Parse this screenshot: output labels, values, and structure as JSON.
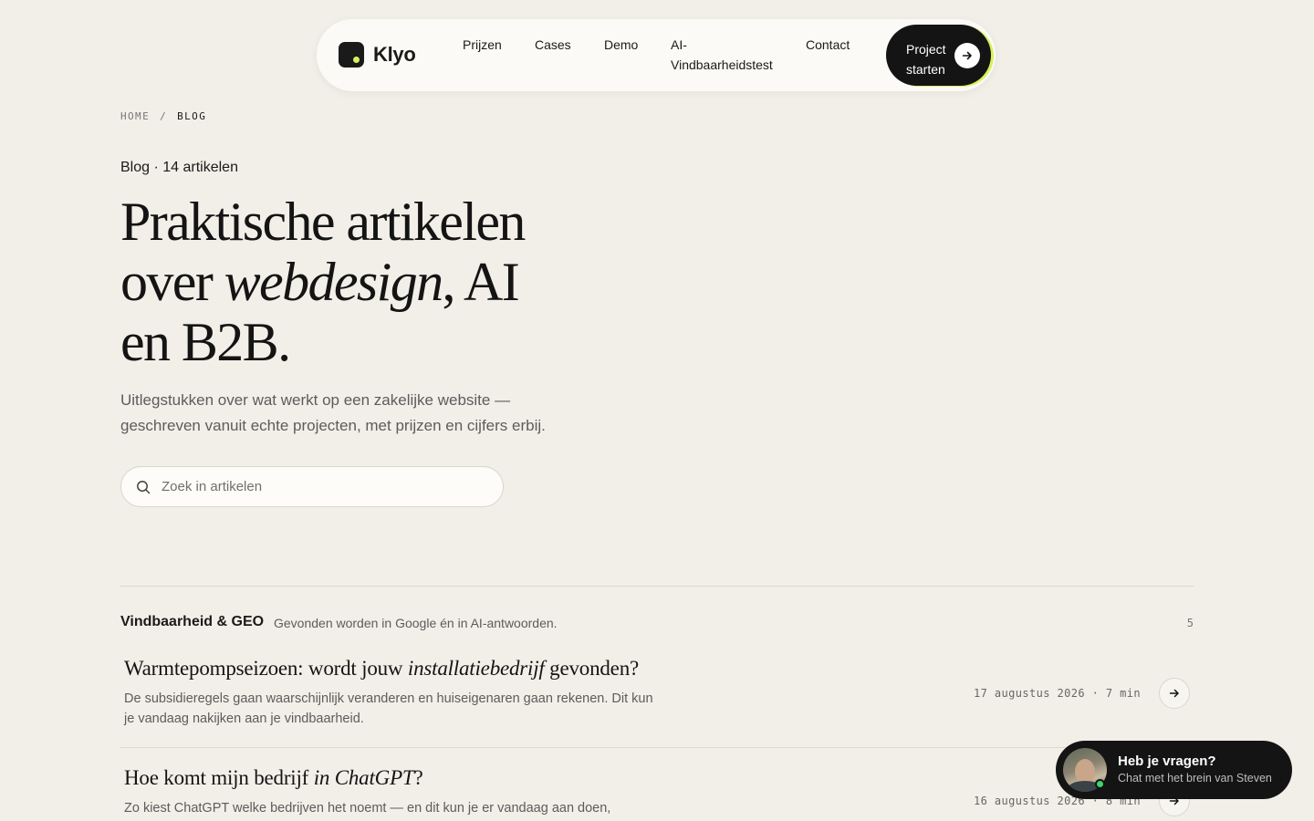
{
  "nav": {
    "brand": "Klyo",
    "links": [
      "Prijzen",
      "Cases",
      "Demo",
      "AI-\nVindbaarheidstest",
      "Contact"
    ],
    "cta_label": "Project starten",
    "accent": "#d7f25c"
  },
  "breadcrumb": {
    "home": "HOME",
    "sep": "/",
    "current": "BLOG"
  },
  "hero": {
    "kicker": "Blog · 14 artikelen",
    "title_line1": "Praktische artikelen",
    "title_over": "over ",
    "title_em": "webdesign",
    "title_after": ", AI",
    "title_line3": "en B2B.",
    "subtitle": "Uitlegstukken over wat werkt op een zakelijke website — geschreven vanuit echte projecten, met prijzen en cijfers erbij."
  },
  "search": {
    "placeholder": "Zoek in artikelen",
    "value": ""
  },
  "section": {
    "name": "Vindbaarheid & GEO",
    "description": "Gevonden worden in Google én in AI-antwoorden.",
    "count": "5"
  },
  "articles": [
    {
      "title_before": "Warmtepompseizoen: wordt jouw ",
      "title_em": "installatiebedrijf",
      "title_after": " gevonden?",
      "excerpt": "De subsidieregels gaan waarschijnlijk veranderen en huiseigenaren gaan rekenen. Dit kun je vandaag nakijken aan je vindbaarheid.",
      "meta": "17 augustus 2026 · 7 min"
    },
    {
      "title_before": "Hoe komt mijn bedrijf ",
      "title_em": "in ChatGPT",
      "title_after": "?",
      "excerpt": "Zo kiest ChatGPT welke bedrijven het noemt — en dit kun je er vandaag aan doen,",
      "meta": "16 augustus 2026 · 8 min"
    }
  ],
  "chat": {
    "title": "Heb je vragen?",
    "subtitle": "Chat met het brein van Steven",
    "status_color": "#3ed46a"
  }
}
